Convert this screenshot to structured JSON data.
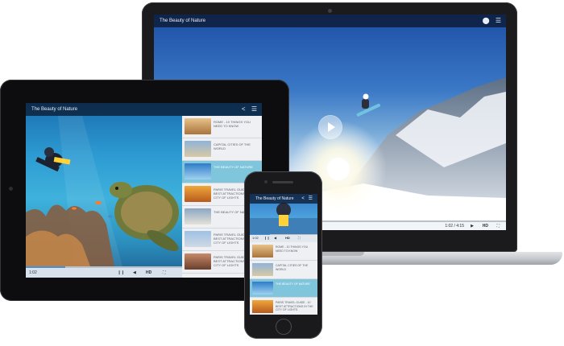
{
  "laptop": {
    "title": "The Beauty of Nature",
    "time": "1:02 / 4:15",
    "hd_label": "HD",
    "progress": 0.45
  },
  "tablet": {
    "title": "The Beauty of Nature",
    "time": "1:02",
    "hd_label": "HD",
    "progress": 0.25,
    "playlist": [
      {
        "label": "ROME - 10 THINGS YOU NEED TO KNOW",
        "active": false
      },
      {
        "label": "CAPITAL CITIES OF THE WORLD",
        "active": false
      },
      {
        "label": "THE BEAUTY OF NATURE",
        "active": true
      },
      {
        "label": "PARIS TRAVEL GUIDE - 10 BEST ATTRACTIONS IN THE CITY OF LIGHTS",
        "active": false
      },
      {
        "label": "THE BEAUTY OF NATURE",
        "active": false
      },
      {
        "label": "PARIS TRAVEL GUIDE - 10 BEST ATTRACTIONS IN THE CITY OF LIGHTS",
        "active": false
      },
      {
        "label": "PARIS TRAVEL GUIDE - 10 BEST ATTRACTIONS IN THE CITY OF LIGHTS",
        "active": false
      }
    ]
  },
  "phone": {
    "title": "The Beauty of Nature",
    "time": "1:02",
    "hd_label": "HD",
    "progress": 0.3,
    "playlist": [
      {
        "label": "ROME - 10 THINGS YOU NEED TO KNOW",
        "active": false
      },
      {
        "label": "CAPITAL CITIES OF THE WORLD",
        "active": false
      },
      {
        "label": "THE BEAUTY OF NATURE",
        "active": true
      },
      {
        "label": "PARIS TRAVEL GUIDE - 10 BEST ATTRACTIONS IN THE CITY OF LIGHTS",
        "active": false
      }
    ]
  },
  "colors": {
    "accent": "#4a90d9",
    "active_item": "#7fc6dd"
  }
}
